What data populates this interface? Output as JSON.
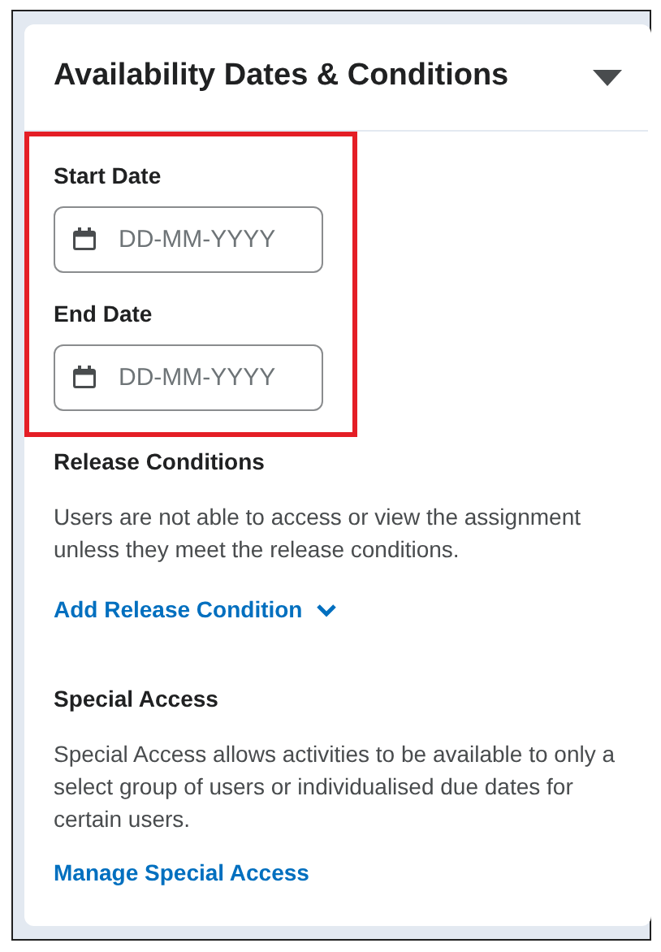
{
  "panel": {
    "title": "Availability Dates & Conditions",
    "expanded": true
  },
  "dates": {
    "highlighted": true,
    "fields": [
      {
        "label": "Start Date",
        "placeholder": "DD-MM-YYYY"
      },
      {
        "label": "End Date",
        "placeholder": "DD-MM-YYYY"
      }
    ]
  },
  "release_conditions": {
    "heading": "Release Conditions",
    "description": "Users are not able to access or view the assignment unless they meet the release conditions.",
    "link": "Add Release Condition"
  },
  "special_access": {
    "heading": "Special Access",
    "description": "Special Access allows activities to be available to only a select group of users or individualised due dates for certain users.",
    "link": "Manage Special Access"
  }
}
